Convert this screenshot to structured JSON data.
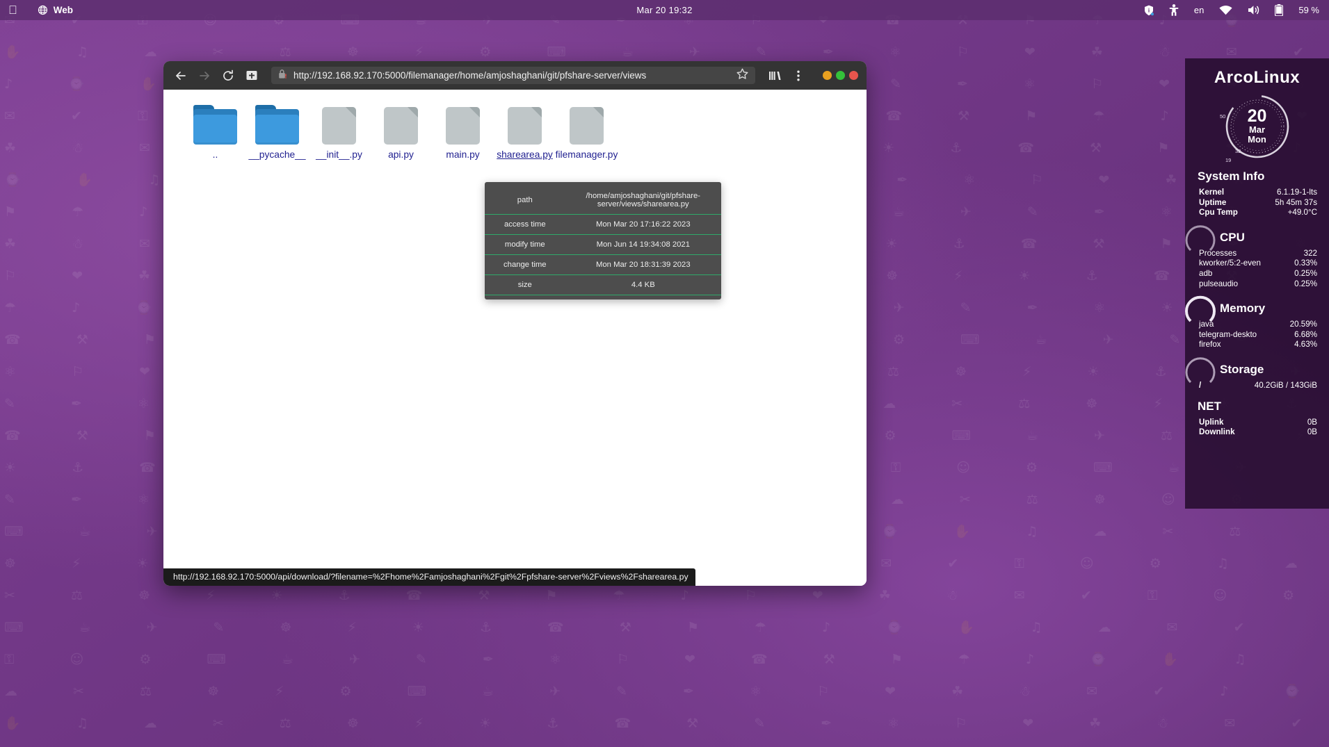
{
  "topbar": {
    "apple_icon": "apple-logo-icon",
    "app_name": "Web",
    "app_icon": "globe-icon",
    "clock": "Mar 20  19:32",
    "tray": [
      {
        "name": "shield-icon",
        "glyph": "⛨"
      },
      {
        "name": "accessibility-icon",
        "glyph": "♿"
      },
      {
        "name": "keyboard-layout",
        "label": "en"
      },
      {
        "name": "wifi-icon",
        "glyph": "▼"
      },
      {
        "name": "volume-icon",
        "glyph": "🔊"
      },
      {
        "name": "battery-icon",
        "glyph": "▮"
      }
    ],
    "battery_percent": "59 %"
  },
  "browser": {
    "nav": {
      "back": "←",
      "forward": "→",
      "reload": "↻",
      "reader": "reader-mode-icon"
    },
    "url": "http://192.168.92.170:5000/filemanager/home/amjoshaghani/git/pfshare-server/views",
    "lock_icon": "insecure-lock-icon",
    "bookmark_icon": "star-icon",
    "library_icon": "library-icon",
    "menu_icon": "kebab-menu-icon",
    "window_buttons": {
      "minimize_color": "#e8a020",
      "maximize_color": "#34c13a",
      "close_color": "#e8554d"
    },
    "status_link": "http://192.168.92.170:5000/api/download/?filename=%2Fhome%2Famjoshaghani%2Fgit%2Fpfshare-server%2Fviews%2Fsharearea.py"
  },
  "files": [
    {
      "name": "..",
      "type": "folder",
      "hovered": false
    },
    {
      "name": "__pycache__",
      "type": "folder",
      "hovered": false
    },
    {
      "name": "__init__.py",
      "type": "file",
      "hovered": false
    },
    {
      "name": "api.py",
      "type": "file",
      "hovered": false
    },
    {
      "name": "main.py",
      "type": "file",
      "hovered": false
    },
    {
      "name": "sharearea.py",
      "type": "file",
      "hovered": true
    },
    {
      "name": "filemanager.py",
      "type": "file",
      "hovered": false
    }
  ],
  "tooltip": {
    "rows": [
      {
        "key": "path",
        "value": "/home/amjoshaghani/git/pfshare-server/views/sharearea.py"
      },
      {
        "key": "access time",
        "value": "Mon Mar 20 17:16:22 2023"
      },
      {
        "key": "modify time",
        "value": "Mon Jun 14 19:34:08 2021"
      },
      {
        "key": "change time",
        "value": "Mon Mar 20 18:31:39 2023"
      },
      {
        "key": "size",
        "value": "4.4 KB"
      }
    ],
    "divider_color": "#2faa6a"
  },
  "conky": {
    "title": "ArcoLinux",
    "clock": {
      "day": "20",
      "month": "Mar",
      "weekday": "Mon",
      "ticks": [
        "50",
        "32",
        "19"
      ]
    },
    "system_info": {
      "heading": "System Info",
      "rows": [
        {
          "key": "Kernel",
          "value": "6.1.19-1-lts"
        },
        {
          "key": "Uptime",
          "value": "5h 45m 37s"
        },
        {
          "key": "Cpu Temp",
          "value": "+49.0°C"
        }
      ]
    },
    "cpu": {
      "heading": "CPU",
      "rows": [
        {
          "key": "Processes",
          "value": "322"
        },
        {
          "key": "kworker/5:2-even",
          "value": "0.33%"
        },
        {
          "key": "adb",
          "value": "0.25%"
        },
        {
          "key": "pulseaudio",
          "value": "0.25%"
        }
      ]
    },
    "memory": {
      "heading": "Memory",
      "rows": [
        {
          "key": "java",
          "value": "20.59%"
        },
        {
          "key": "telegram-deskto",
          "value": "6.68%"
        },
        {
          "key": "firefox",
          "value": "4.63%"
        }
      ]
    },
    "storage": {
      "heading": "Storage",
      "rows": [
        {
          "key": "/",
          "value": "40.2GiB / 143GiB"
        }
      ]
    },
    "net": {
      "heading": "NET",
      "rows": [
        {
          "key": "Uplink",
          "value": "0B"
        },
        {
          "key": "Downlink",
          "value": "0B"
        }
      ]
    }
  }
}
